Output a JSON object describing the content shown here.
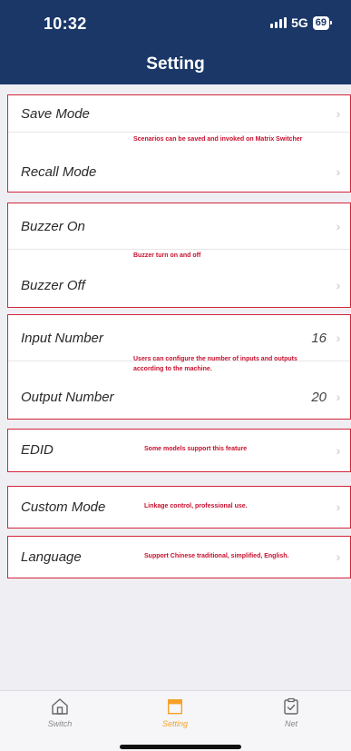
{
  "status": {
    "time": "10:32",
    "network": "5G",
    "battery": "69"
  },
  "header": {
    "title": "Setting"
  },
  "groups": {
    "mode": {
      "save_label": "Save Mode",
      "recall_label": "Recall Mode",
      "note": "Scenarios can be saved and invoked on Matrix Switcher"
    },
    "buzzer": {
      "on_label": "Buzzer On",
      "off_label": "Buzzer Off",
      "note": "Buzzer turn on and off"
    },
    "io": {
      "input_label": "Input Number",
      "input_value": "16",
      "output_label": "Output Number",
      "output_value": "20",
      "note_line1": "Users can configure the number of inputs and outputs",
      "note_line2": "according to the machine."
    },
    "edid": {
      "label": "EDID",
      "note": "Some models support this feature"
    },
    "custom": {
      "label": "Custom Mode",
      "note": "Linkage control, professional use."
    },
    "language": {
      "label": "Language",
      "note": "Support Chinese traditional, simplified, English."
    }
  },
  "tabs": [
    {
      "label": "Switch",
      "icon": "home-icon",
      "active": false
    },
    {
      "label": "Setting",
      "icon": "setting-tab-icon",
      "active": true
    },
    {
      "label": "Net",
      "icon": "clipboard-check-icon",
      "active": false
    }
  ],
  "colors": {
    "header": "#1a3768",
    "accent": "#f4a12a",
    "annotation": "#c8102e"
  }
}
